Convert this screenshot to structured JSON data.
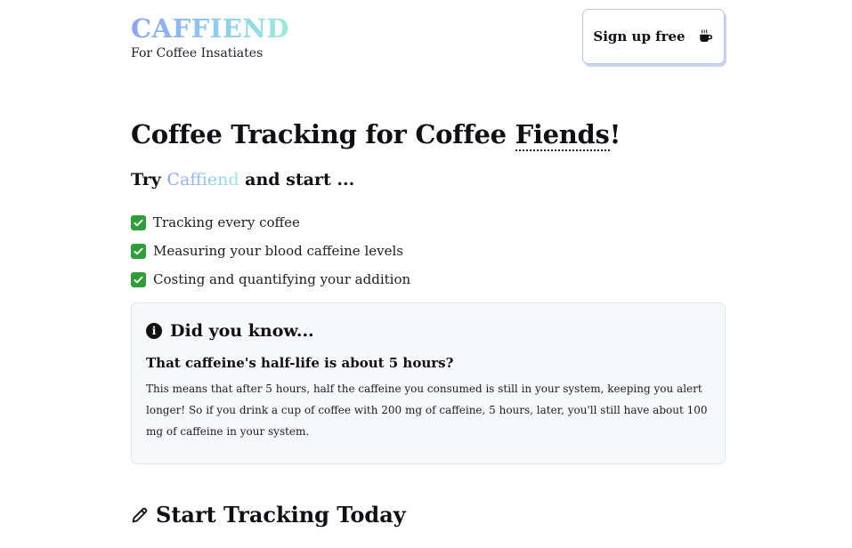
{
  "header": {
    "logo": "CAFFIEND",
    "tagline": "For Coffee Insatiates",
    "signup_label": "Sign up free"
  },
  "hero": {
    "headline_before": "Coffee Tracking for Coffee ",
    "headline_highlight": "Fiends",
    "headline_after": "!",
    "sub_before": "Try ",
    "sub_brand": "Caffiend",
    "sub_after": " and start ..."
  },
  "features": [
    "Tracking every coffee",
    "Measuring your blood caffeine levels",
    "Costing and quantifying your addition"
  ],
  "did_you_know": {
    "title": "Did you know...",
    "fact": "That caffeine's half-life is about 5 hours?",
    "body": "This means that after 5 hours, half the caffeine you consumed is still in your system, keeping you alert longer! So if you drink a cup of coffee with 200 mg of caffeine, 5 hours, later, you'll still have about 100 mg of caffeine in your system."
  },
  "tracking": {
    "title": "Start Tracking Today"
  },
  "colors": {
    "brand_gradient": [
      "#8da2f2",
      "#8fcdf0",
      "#9bead8"
    ],
    "check_green": "#2e9d3a",
    "info_bg": "#f7f8fa"
  },
  "icons": {
    "signup": "coffee-cup-icon",
    "feature": "check-icon",
    "info": "info-circle-icon",
    "tracking": "pencil-icon"
  }
}
